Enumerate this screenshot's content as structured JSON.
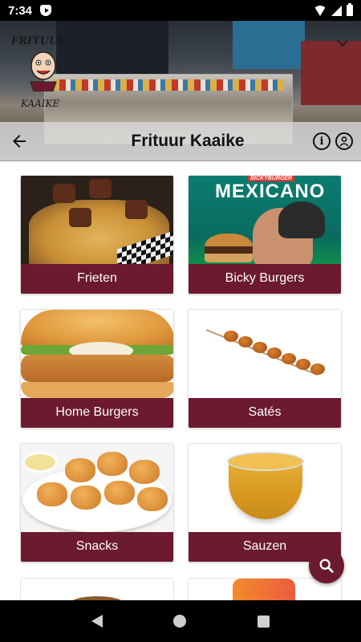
{
  "status_bar": {
    "time": "7:34"
  },
  "banner": {
    "logo_text_top": "FRITUUR",
    "logo_text_bottom": "KAAIKE"
  },
  "toolbar": {
    "title": "Frituur Kaaike",
    "back_icon": "arrow-back-icon",
    "info_icon": "info-icon",
    "account_icon": "account-circle-icon"
  },
  "categories": [
    {
      "label": "Frieten"
    },
    {
      "label": "Bicky Burgers",
      "image_text": "MEXICANO",
      "image_badge": "BICKYBURGER"
    },
    {
      "label": "Home Burgers"
    },
    {
      "label": "Satés"
    },
    {
      "label": "Snacks"
    },
    {
      "label": "Sauzen"
    }
  ],
  "fab": {
    "icon": "search-icon"
  },
  "colors": {
    "accent": "#6b1a30",
    "toolbar_bg": "#d7d7d7"
  }
}
